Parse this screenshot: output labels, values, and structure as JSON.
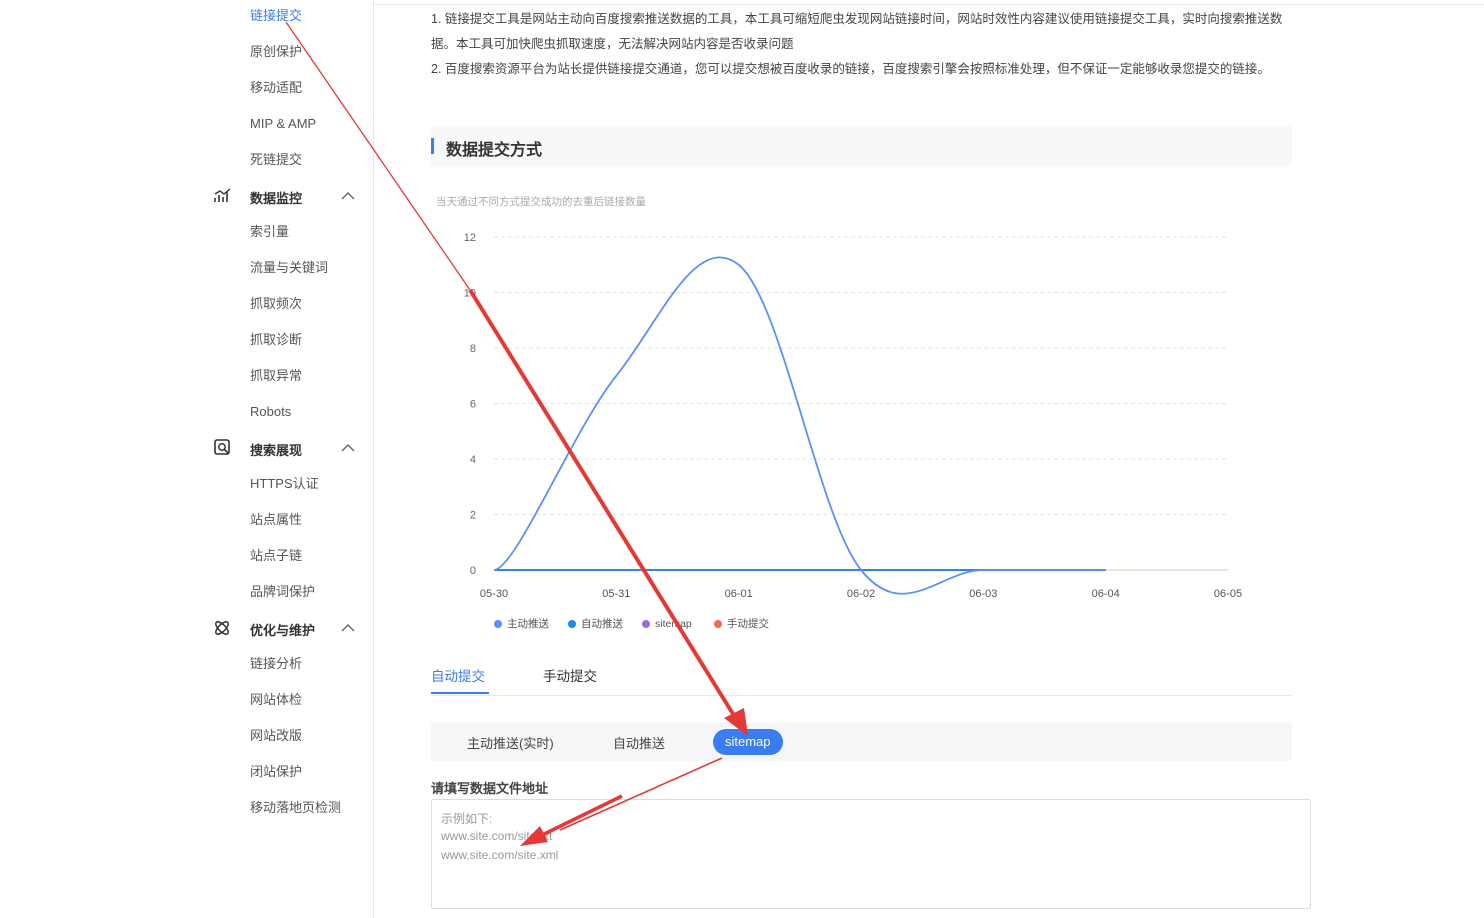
{
  "sidebar": {
    "items_top": [
      "链接提交",
      "原创保护",
      "移动适配",
      "MIP & AMP",
      "死链提交"
    ],
    "groups": [
      {
        "label": "数据监控",
        "icon": "chart-icon",
        "items": [
          "索引量",
          "流量与关键词",
          "抓取频次",
          "抓取诊断",
          "抓取异常",
          "Robots"
        ]
      },
      {
        "label": "搜索展现",
        "icon": "search-display-icon",
        "items": [
          "HTTPS认证",
          "站点属性",
          "站点子链",
          "品牌词保护"
        ]
      },
      {
        "label": "优化与维护",
        "icon": "atom-icon",
        "items": [
          "链接分析",
          "网站体检",
          "网站改版",
          "闭站保护",
          "移动落地页检测"
        ]
      }
    ]
  },
  "intro": {
    "line1": "1. 链接提交工具是网站主动向百度搜索推送数据的工具，本工具可缩短爬虫发现网站链接时间，网站时效性内容建议使用链接提交工具，实时向搜索推送数",
    "line2": "据。本工具可加快爬虫抓取速度，无法解决网站内容是否收录问题",
    "line3": "2. 百度搜索资源平台为站长提供链接提交通道，您可以提交想被百度收录的链接，百度搜索引擎会按照标准处理，但不保证一定能够收录您提交的链接。"
  },
  "section": {
    "title": "数据提交方式"
  },
  "chart_data": {
    "type": "line",
    "title": "当天通过不同方式提交成功的去重后链接数量",
    "categories": [
      "05-30",
      "05-31",
      "06-01",
      "06-02",
      "06-03",
      "06-04",
      "06-05"
    ],
    "ylim": [
      0,
      12
    ],
    "yticks": [
      0,
      2,
      4,
      6,
      8,
      10,
      12
    ],
    "grid": true,
    "legend_position": "bottom",
    "series": [
      {
        "name": "主动推送",
        "color": "#5b8ff9",
        "values": [
          0,
          7,
          11,
          0,
          0,
          0,
          null
        ]
      },
      {
        "name": "自动推送",
        "color": "#1e88e5",
        "values": [
          0,
          0,
          0,
          0,
          0,
          0,
          null
        ]
      },
      {
        "name": "sitemap",
        "color": "#9c6ade",
        "values": [
          0,
          0,
          0,
          0,
          0,
          0,
          null
        ]
      },
      {
        "name": "手动提交",
        "color": "#f06a4f",
        "values": [
          0,
          0,
          0,
          0,
          0,
          0,
          null
        ]
      }
    ]
  },
  "tabs": {
    "items": [
      "自动提交",
      "手动提交"
    ],
    "active": "自动提交"
  },
  "subtabs": {
    "items": [
      "主动推送(实时)",
      "自动推送",
      "sitemap"
    ],
    "active": "sitemap"
  },
  "form": {
    "label": "请填写数据文件地址",
    "placeholder_lines": [
      "示例如下:",
      "www.site.com/site.txt",
      "www.site.com/site.xml"
    ]
  },
  "colors": {
    "accent": "#3b7cf0",
    "annotation_arrow": "#e53935"
  }
}
